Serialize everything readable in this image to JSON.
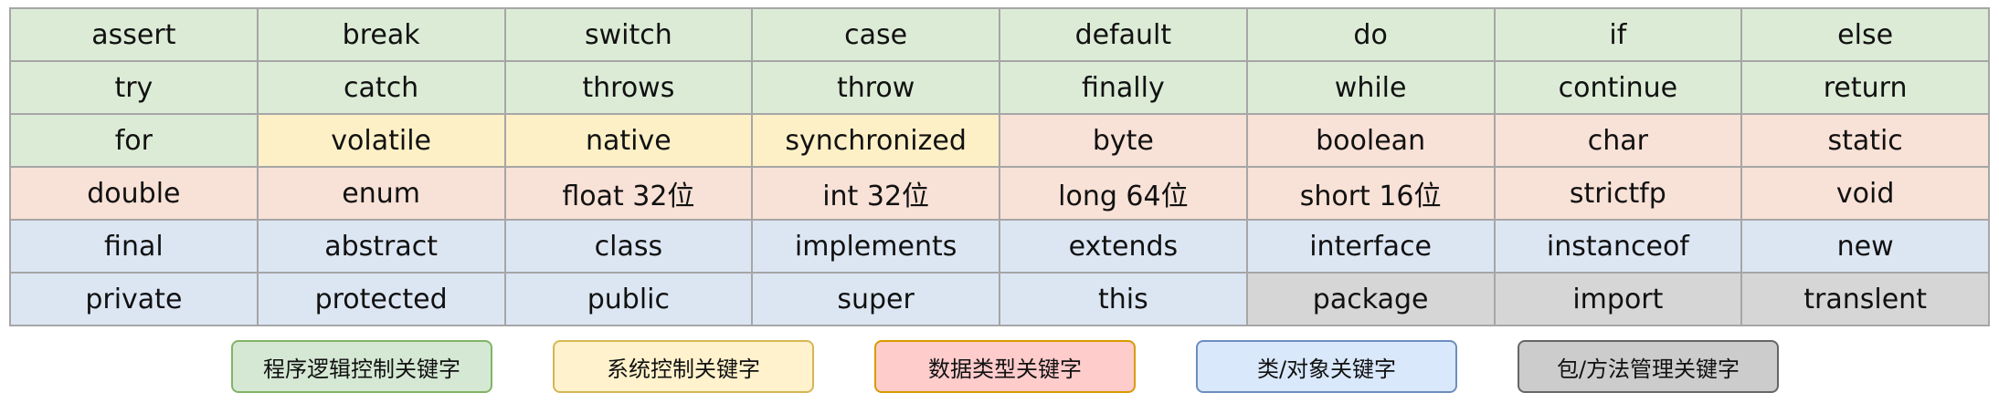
{
  "grid": {
    "rows": [
      [
        {
          "text": "assert",
          "cat": "flow"
        },
        {
          "text": "break",
          "cat": "flow"
        },
        {
          "text": "switch",
          "cat": "flow"
        },
        {
          "text": "case",
          "cat": "flow"
        },
        {
          "text": "default",
          "cat": "flow"
        },
        {
          "text": "do",
          "cat": "flow"
        },
        {
          "text": "if",
          "cat": "flow"
        },
        {
          "text": "else",
          "cat": "flow"
        }
      ],
      [
        {
          "text": "try",
          "cat": "flow"
        },
        {
          "text": "catch",
          "cat": "flow"
        },
        {
          "text": "throws",
          "cat": "flow"
        },
        {
          "text": "throw",
          "cat": "flow"
        },
        {
          "text": "finally",
          "cat": "flow"
        },
        {
          "text": "while",
          "cat": "flow"
        },
        {
          "text": "continue",
          "cat": "flow"
        },
        {
          "text": "return",
          "cat": "flow"
        }
      ],
      [
        {
          "text": "for",
          "cat": "flow"
        },
        {
          "text": "volatile",
          "cat": "sys"
        },
        {
          "text": "native",
          "cat": "sys"
        },
        {
          "text": "synchronized",
          "cat": "sys"
        },
        {
          "text": "byte",
          "cat": "data"
        },
        {
          "text": "boolean",
          "cat": "data"
        },
        {
          "text": "char",
          "cat": "data"
        },
        {
          "text": "static",
          "cat": "data"
        }
      ],
      [
        {
          "text": "double",
          "cat": "data"
        },
        {
          "text": "enum",
          "cat": "data"
        },
        {
          "text": "float 32位",
          "cat": "data"
        },
        {
          "text": "int 32位",
          "cat": "data"
        },
        {
          "text": "long 64位",
          "cat": "data"
        },
        {
          "text": "short 16位",
          "cat": "data"
        },
        {
          "text": "strictfp",
          "cat": "data"
        },
        {
          "text": "void",
          "cat": "data"
        }
      ],
      [
        {
          "text": "final",
          "cat": "cls"
        },
        {
          "text": "abstract",
          "cat": "cls"
        },
        {
          "text": "class",
          "cat": "cls"
        },
        {
          "text": "implements",
          "cat": "cls"
        },
        {
          "text": "extends",
          "cat": "cls"
        },
        {
          "text": "interface",
          "cat": "cls"
        },
        {
          "text": "instanceof",
          "cat": "cls"
        },
        {
          "text": "new",
          "cat": "cls"
        }
      ],
      [
        {
          "text": "private",
          "cat": "cls"
        },
        {
          "text": "protected",
          "cat": "cls"
        },
        {
          "text": "public",
          "cat": "cls"
        },
        {
          "text": "super",
          "cat": "cls"
        },
        {
          "text": "this",
          "cat": "cls"
        },
        {
          "text": "package",
          "cat": "pkg"
        },
        {
          "text": "import",
          "cat": "pkg"
        },
        {
          "text": "translent",
          "cat": "pkg"
        }
      ]
    ]
  },
  "legend": [
    {
      "label": "程序逻辑控制关键字",
      "fill": "#d5e8d4",
      "border": "#82b366"
    },
    {
      "label": "系统控制关键字",
      "fill": "#fff2cc",
      "border": "#d6b656"
    },
    {
      "label": "数据类型关键字",
      "fill": "#ffcccc",
      "border": "#d79b00"
    },
    {
      "label": "类/对象关键字",
      "fill": "#dae8fc",
      "border": "#6c8ebf"
    },
    {
      "label": "包/方法管理关键字",
      "fill": "#cccccc",
      "border": "#666666"
    }
  ]
}
